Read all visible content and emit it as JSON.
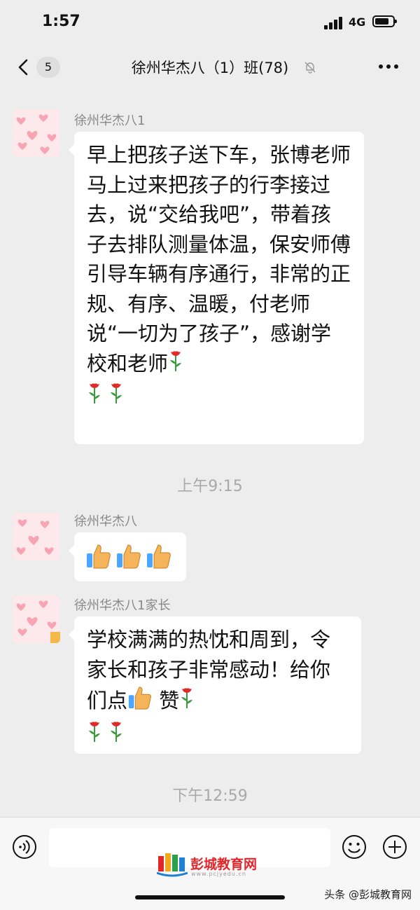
{
  "status": {
    "time": "1:57",
    "network": "4G",
    "battery_level": 0.8
  },
  "nav": {
    "unread_count": "5",
    "title": "徐州华杰八（1）班(78)"
  },
  "messages": [
    {
      "sender": "徐州华杰八1",
      "text": "早上把孩子送下车，张博老师马上过来把孩子的行李接过去，说“交给我吧”，带着孩子去排队测量体温，保安师傅引导车辆有序通行，非常的正规、有序、温暖，付老师说“一切为了孩子”，感谢学校和老师"
    },
    {
      "sender": "徐州华杰八"
    },
    {
      "sender": "徐州华杰八1家长",
      "text_before": "学校满满的热忱和周到，令家长和孩子非常感动！给你们点",
      "text_after": "赞"
    }
  ],
  "timestamps": {
    "t1": "上午9:15",
    "t2": "下午12:59"
  },
  "input": {
    "placeholder": ""
  },
  "watermark": {
    "name": "彭城教育网",
    "url": "www.pcjyedu.cn"
  },
  "credit": "头条 @彭城教育网",
  "icons": {
    "rose": "rose-icon",
    "thumbs": "thumbs-up-icon",
    "voice": "voice-icon",
    "emoji": "emoji-icon",
    "plus": "plus-icon"
  },
  "colors": {
    "background": "#ededed",
    "bubble": "#ffffff",
    "watermark_red": "#e2262a"
  }
}
